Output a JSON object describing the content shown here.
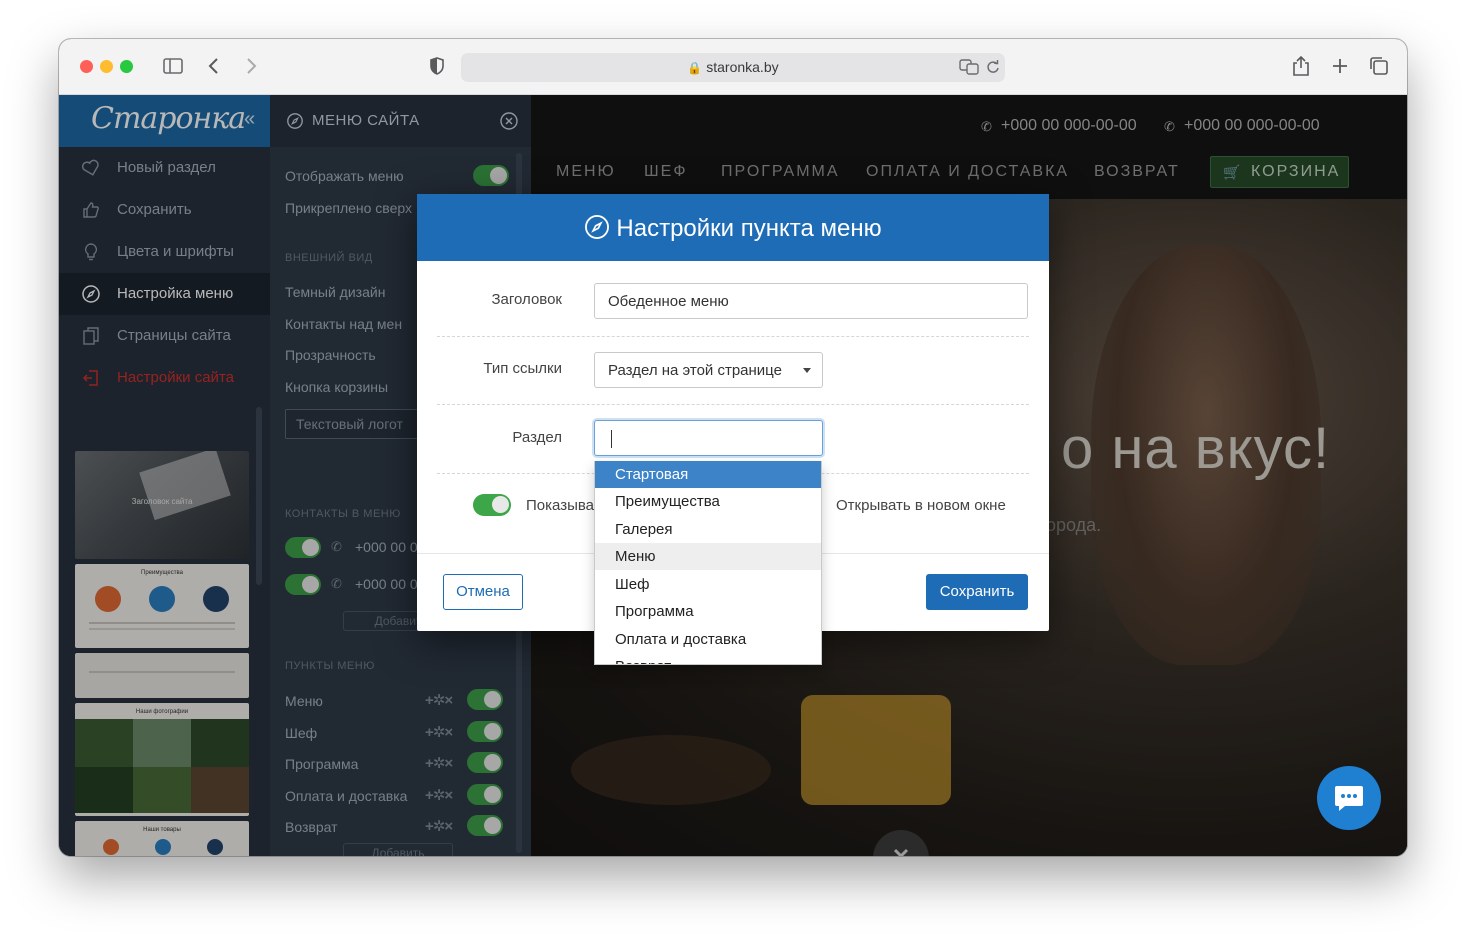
{
  "browser": {
    "url": "staronka.by"
  },
  "sidebar": {
    "logo": "Старонка",
    "items": [
      {
        "label": "Новый раздел",
        "icon": "heart-icon"
      },
      {
        "label": "Сохранить",
        "icon": "thumbs-up-icon"
      },
      {
        "label": "Цвета и шрифты",
        "icon": "lightbulb-icon"
      },
      {
        "label": "Настройка меню",
        "icon": "compass-icon"
      },
      {
        "label": "Страницы сайта",
        "icon": "pages-icon"
      },
      {
        "label": "Настройки сайта",
        "icon": "exit-icon"
      }
    ],
    "thumbs": [
      "Заголовок сайта",
      "Преимущества",
      "Наши фотографии",
      "Наши товары"
    ]
  },
  "panel": {
    "title": "МЕНЮ САЙТА",
    "show_menu": "Отображать меню",
    "pinned": "Прикреплено сверх",
    "section_view": "ВНЕШНИЙ ВИД",
    "dark_design": "Темный дизайн",
    "contacts_over": "Контакты над мен",
    "transparency": "Прозрачность",
    "cart_button": "Кнопка корзины",
    "text_logo": "Текстовый логот",
    "section_contacts": "КОНТАКТЫ В МЕНЮ",
    "contacts": [
      "+000 00 0",
      "+000 00 0"
    ],
    "add_label": "Добавит",
    "section_items": "ПУНКТЫ МЕНЮ",
    "menu_items": [
      "Меню",
      "Шеф",
      "Программа",
      "Оплата и доставка",
      "Возврат"
    ],
    "add_full": "Добавить"
  },
  "site": {
    "phones": [
      "+000 00 000-00-00",
      "+000 00 000-00-00"
    ],
    "nav": [
      "МЕНЮ",
      "ШЕФ",
      "ПРОГРАММА",
      "ОПЛАТА И ДОСТАВКА",
      "ВОЗВРАТ"
    ],
    "cart": "КОРЗИНА",
    "hero_big": "о на вкус!",
    "hero_small": "орода."
  },
  "modal": {
    "title": "Настройки пункта меню",
    "heading_label": "Заголовок",
    "heading_value": "Обеденное меню",
    "link_type_label": "Тип ссылки",
    "link_type_value": "Раздел на этой странице",
    "section_label": "Раздел",
    "section_value": "",
    "show_label": "Показыва",
    "new_window_label": "Открывать в новом окне",
    "cancel": "Отмена",
    "save": "Сохранить",
    "options": [
      "Стартовая",
      "Преимущества",
      "Галерея",
      "Меню",
      "Шеф",
      "Программа",
      "Оплата и доставка",
      "Возврат"
    ],
    "selected_option": "Стартовая",
    "hover_option": "Меню"
  }
}
